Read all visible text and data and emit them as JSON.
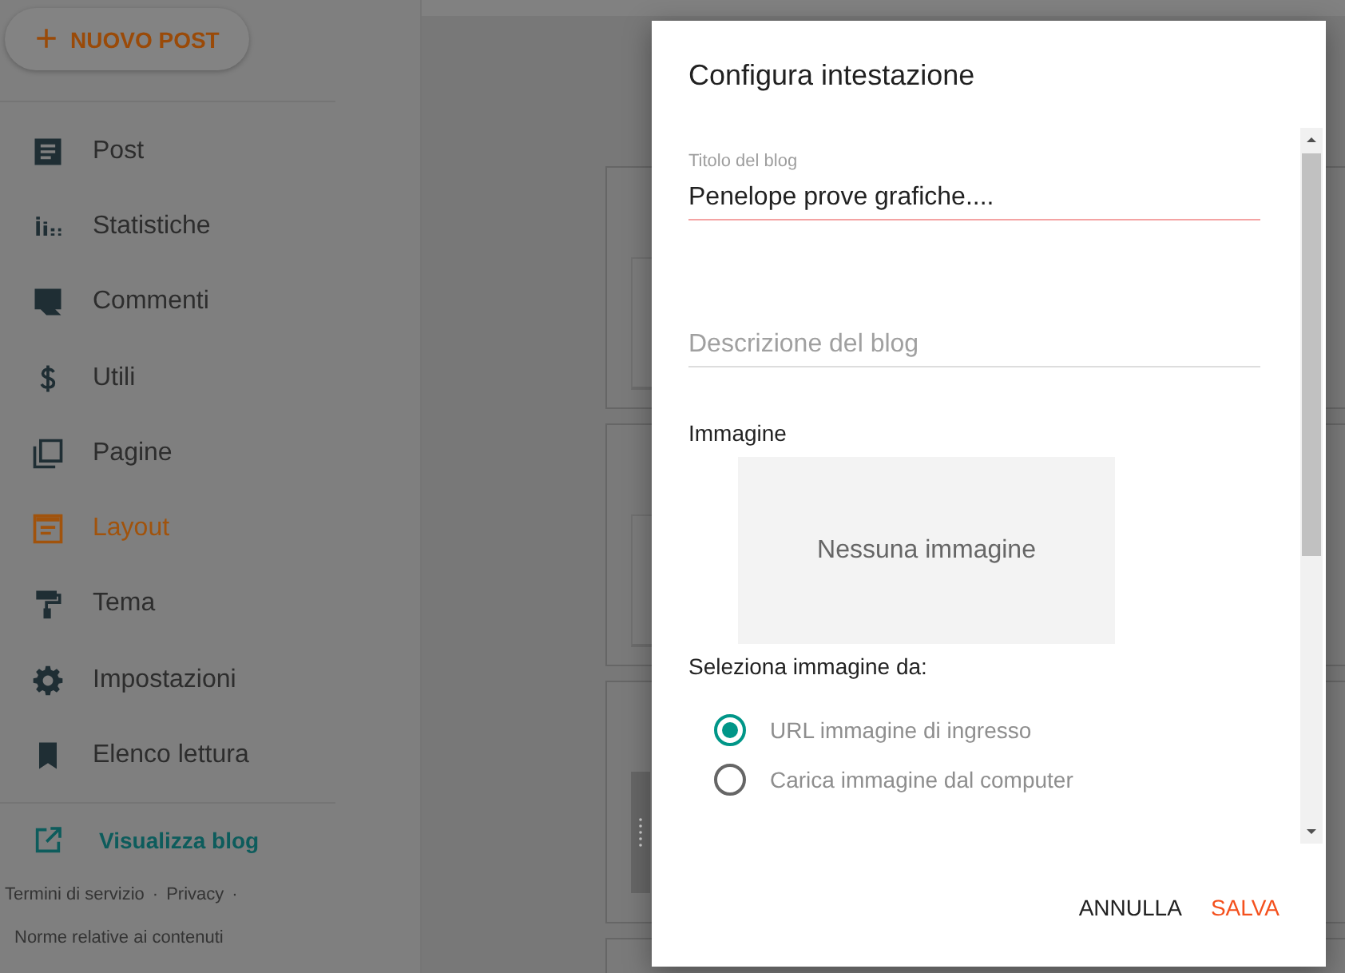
{
  "sidebar": {
    "new_post_button": {
      "label": "NUOVO POST",
      "icon": "+"
    },
    "items": [
      {
        "label": "Post",
        "selected": false
      },
      {
        "label": "Statistiche",
        "selected": false
      },
      {
        "label": "Commenti",
        "selected": false
      },
      {
        "label": "Utili",
        "selected": false
      },
      {
        "label": "Pagine",
        "selected": false
      },
      {
        "label": "Layout",
        "selected": true
      },
      {
        "label": "Tema",
        "selected": false
      },
      {
        "label": "Impostazioni",
        "selected": false
      },
      {
        "label": "Elenco lettura",
        "selected": false
      }
    ],
    "view_blog_link": "Visualizza blog",
    "footer_links": [
      "Termini di servizio",
      "Privacy",
      "Norme relative ai contenuti"
    ],
    "footer_separator": "·"
  },
  "dialog": {
    "title": "Configura intestazione",
    "title_field": {
      "label": "Titolo del blog",
      "value": "Penelope prove grafiche...."
    },
    "description_field": {
      "placeholder": "Descrizione del blog"
    },
    "image_label": "Immagine",
    "image_placeholder": "Nessuna immagine",
    "source_label": "Seleziona immagine da:",
    "sources": [
      {
        "label": "URL immagine di ingresso",
        "selected": true
      },
      {
        "label": "Carica immagine dal computer",
        "selected": false
      }
    ],
    "buttons": [
      {
        "label": "ANNULLA",
        "kind": "cancel"
      },
      {
        "label": "SALVA",
        "kind": "primary"
      }
    ]
  }
}
